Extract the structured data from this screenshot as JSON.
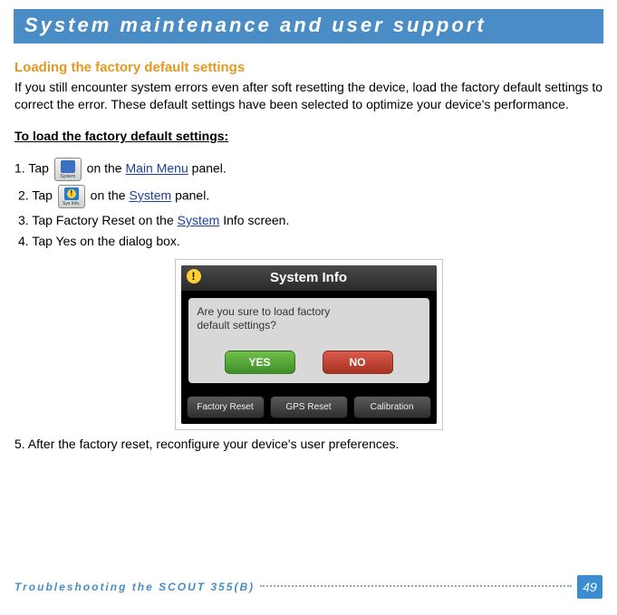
{
  "header": {
    "title": "System maintenance and user support"
  },
  "section": {
    "title": "Loading the factory default settings",
    "intro": "If you still encounter system errors even after soft resetting the device, load the factory default settings to correct the error. These default settings have been selected to optimize your device's performance.",
    "subhead": "To load the factory default settings:"
  },
  "icons": {
    "system_caption": "System",
    "sysinfo_caption": "Sys Info."
  },
  "steps": {
    "s1a": "1. Tap ",
    "s1b": " on the ",
    "s1c": " panel.",
    "link_main": "Main Menu",
    "s2a": "2. Tap ",
    "s2b": " on the ",
    "s2c": " panel.",
    "link_system": "System",
    "s3a": "3. Tap Factory Reset on the ",
    "s3b": " Info screen.",
    "s4": "4. Tap Yes on the dialog box.",
    "s5": "5. After the factory reset, reconfigure your device's user preferences."
  },
  "device": {
    "title": "System Info",
    "dialog_line1": "Are you sure to load factory",
    "dialog_line2": "default settings?",
    "yes": "YES",
    "no": "NO",
    "btn_factory": "Factory Reset",
    "btn_gps": "GPS Reset",
    "btn_cal": "Calibration"
  },
  "footer": {
    "text": "Troubleshooting the SCOUT 355(B)",
    "page": "49"
  }
}
